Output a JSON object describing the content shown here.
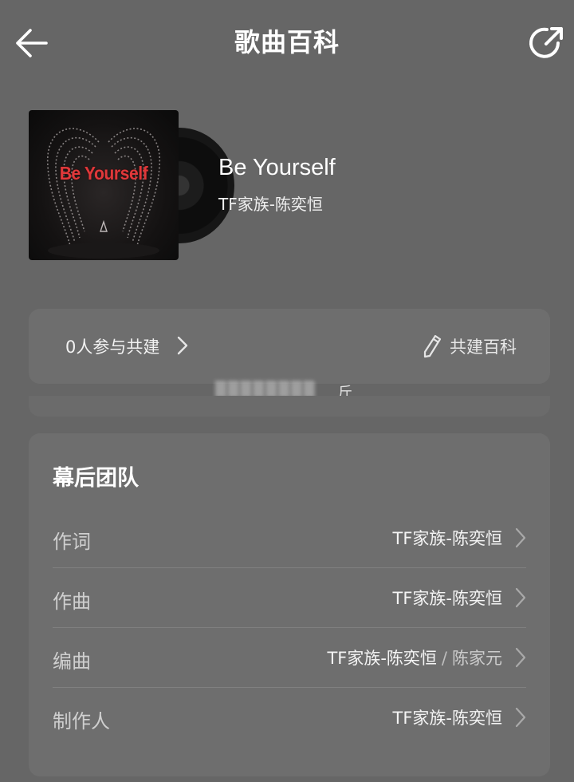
{
  "header": {
    "title": "歌曲百科",
    "back_icon": "arrow-left-icon",
    "share_icon": "share-icon"
  },
  "song": {
    "cover_text": "Be Yourself",
    "title": "Be Yourself",
    "artist": "TF家族-陈奕恒"
  },
  "contribute": {
    "participants_text": "0人参与共建",
    "edit_label": "共建百科",
    "edit_icon": "pencil-icon"
  },
  "blurred_caption": {
    "tail": "斤"
  },
  "team": {
    "title": "幕后团队",
    "rows": [
      {
        "role": "作词",
        "value": "TF家族-陈奕恒"
      },
      {
        "role": "作曲",
        "value": "TF家族-陈奕恒"
      },
      {
        "role": "编曲",
        "value": "TF家族-陈奕恒",
        "separator": "/",
        "secondary": "陈家元"
      },
      {
        "role": "制作人",
        "value": "TF家族-陈奕恒"
      }
    ]
  },
  "colors": {
    "background": "#666666",
    "card": "#6e6e6e",
    "cover_title": "#e0383a"
  }
}
